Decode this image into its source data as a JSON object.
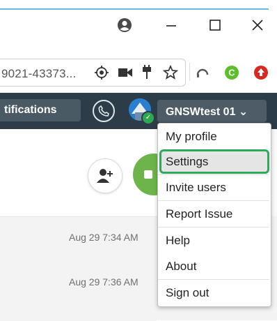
{
  "address_bar": {
    "url_fragment": "9021-43373..."
  },
  "header": {
    "notifications_label": "tifications",
    "user_menu_label": "GNSWtest 01 ⌄"
  },
  "user_menu": {
    "items": [
      {
        "label": "My profile"
      },
      {
        "label": "Settings"
      },
      {
        "label": "Invite users"
      },
      {
        "label": "Report Issue"
      },
      {
        "label": "Help"
      },
      {
        "label": "About"
      },
      {
        "label": "Sign out"
      }
    ],
    "highlighted_item": "Settings"
  },
  "messages": [
    {
      "timestamp": "Aug 29 7:34 AM"
    },
    {
      "timestamp": "Aug 29 7:36 AM"
    }
  ],
  "icons": {
    "account": "account-circle-icon",
    "minimize": "minimize-icon",
    "maximize": "maximize-icon",
    "close": "close-icon",
    "location": "location-target-icon",
    "camera": "video-camera-icon",
    "extension": "plug-icon",
    "bookmark": "star-icon",
    "headset": "headset-icon",
    "ext_green": "green-c-extension-icon",
    "ext_red": "red-upload-extension-icon",
    "phone": "phone-icon",
    "add_user": "add-user-icon",
    "check": "check-badge-icon"
  },
  "colors": {
    "header_bg": "#2c3d49",
    "highlight_border": "#2eaa58",
    "green_action": "#6db54a",
    "top_rule": "#66b7e6"
  }
}
